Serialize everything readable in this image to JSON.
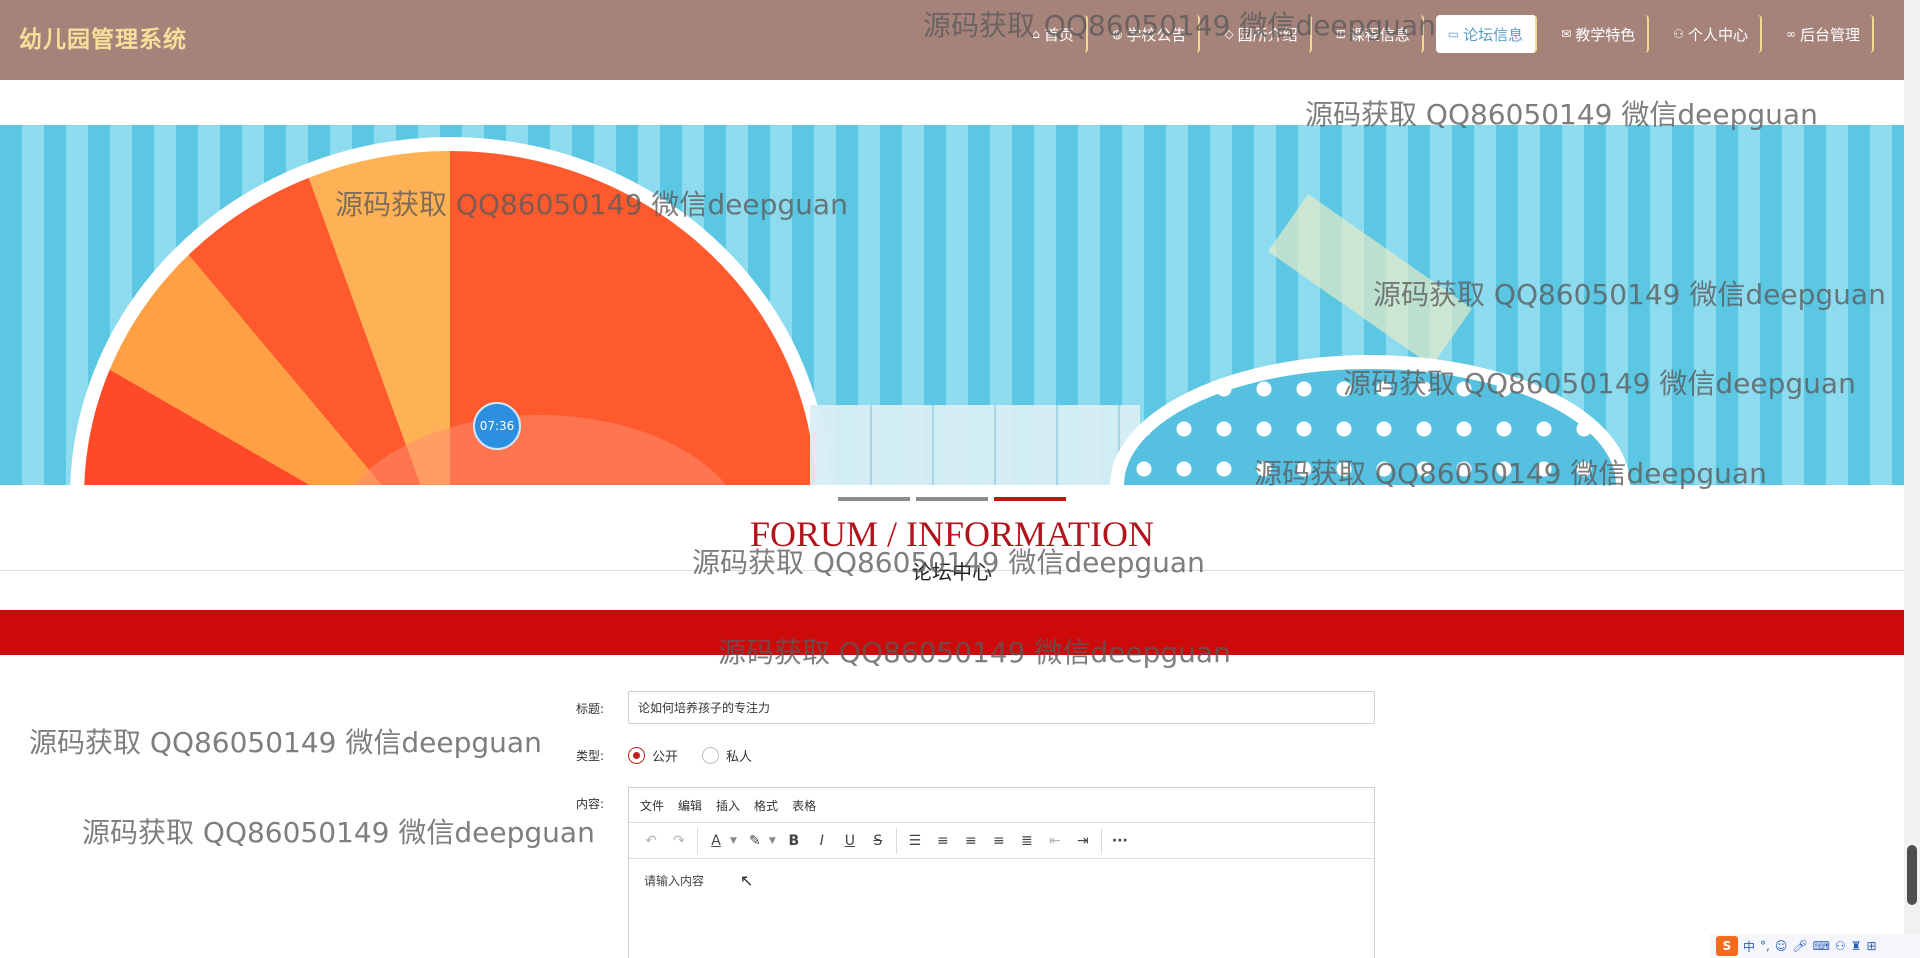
{
  "header": {
    "brand": "幼儿园管理系统",
    "nav": [
      {
        "icon": "home-icon",
        "glyph": "⌂",
        "label": "首页",
        "active": false
      },
      {
        "icon": "globe-icon",
        "glyph": "◍",
        "label": "学校公告",
        "active": false
      },
      {
        "icon": "tag-icon",
        "glyph": "◇",
        "label": "园所介绍",
        "active": false
      },
      {
        "icon": "grid-icon",
        "glyph": "⊞",
        "label": "课程信息",
        "active": false
      },
      {
        "icon": "forum-icon",
        "glyph": "▭",
        "label": "论坛信息",
        "active": true
      },
      {
        "icon": "mail-icon",
        "glyph": "✉",
        "label": "教学特色",
        "active": false
      },
      {
        "icon": "user-icon",
        "glyph": "⚇",
        "label": "个人中心",
        "active": false
      },
      {
        "icon": "link-icon",
        "glyph": "∞",
        "label": "后台管理",
        "active": false
      }
    ]
  },
  "banner": {
    "clock": "07:36"
  },
  "section": {
    "title_en": "FORUM / INFORMATION",
    "title_cn": "论坛中心"
  },
  "form": {
    "title_label": "标题:",
    "title_value": "论如何培养孩子的专注力",
    "type_label": "类型:",
    "type_options": [
      {
        "label": "公开",
        "checked": true
      },
      {
        "label": "私人",
        "checked": false
      }
    ],
    "content_label": "内容:",
    "editor_menu": [
      "文件",
      "编辑",
      "插入",
      "格式",
      "表格"
    ],
    "editor_placeholder": "请输入内容"
  },
  "watermark": "源码获取 QQ86050149 微信deepguan",
  "ime": {
    "logo": "S",
    "lang": "中"
  },
  "colors": {
    "header": "#a6837a",
    "brand": "#f7df9a",
    "accent_red": "#cc0a0a",
    "active_nav_text": "#5aa0c8"
  }
}
